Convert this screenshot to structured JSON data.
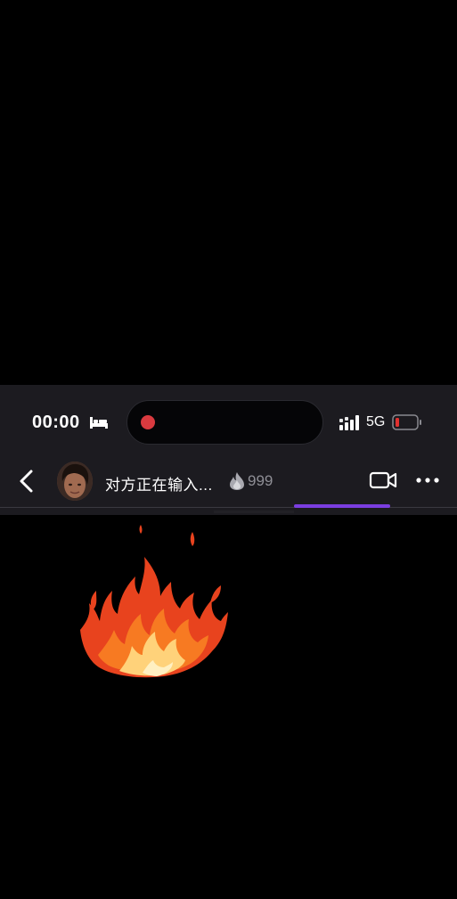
{
  "status_bar": {
    "time": "00:00",
    "network": "5G",
    "recording_color": "#d93a3f",
    "battery_color": "#e0312f"
  },
  "chat_header": {
    "contact_status": "对方正在输入...",
    "streak_count": "999",
    "accent_color": "#7b3ee0"
  },
  "icons": {
    "sleep": "bed-icon",
    "signal": "signal-icon",
    "battery": "battery-icon",
    "back": "chevron-left-icon",
    "streak": "fire-badge-icon",
    "video_call": "video-camera-icon",
    "more": "more-dots-icon"
  },
  "message": {
    "sticker": "fire-sticker"
  }
}
